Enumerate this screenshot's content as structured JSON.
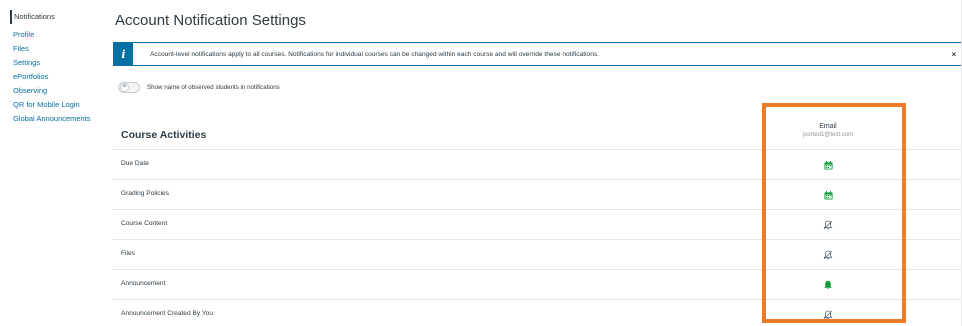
{
  "nav": {
    "items": [
      {
        "label": "Notifications",
        "active": true
      },
      {
        "label": "Profile"
      },
      {
        "label": "Files"
      },
      {
        "label": "Settings"
      },
      {
        "label": "ePortfolios"
      },
      {
        "label": "Observing"
      },
      {
        "label": "QR for Mobile Login"
      },
      {
        "label": "Global Announcements"
      }
    ]
  },
  "page": {
    "title": "Account Notification Settings"
  },
  "banner": {
    "icon": "i",
    "text": "Account-level notifications apply to all courses. Notifications for individual courses can be changed within each course and will override these notifications.",
    "close": "×"
  },
  "toggle": {
    "state_symbol": "×",
    "label": "Show name of observed students in notifications"
  },
  "section": {
    "title": "Course Activities"
  },
  "column": {
    "title": "Email",
    "subtitle": "jsorted1@test.com"
  },
  "rows": [
    {
      "label": "Due Date",
      "icon": "calendar-icon"
    },
    {
      "label": "Grading Policies",
      "icon": "calendar-icon"
    },
    {
      "label": "Course Content",
      "icon": "bell-off-icon"
    },
    {
      "label": "Files",
      "icon": "bell-off-icon"
    },
    {
      "label": "Announcement",
      "icon": "bell-icon"
    },
    {
      "label": "Announcement Created By You",
      "icon": "bell-off-icon"
    }
  ],
  "colors": {
    "link": "#0770a3",
    "text": "#2d3b45",
    "active_green": "#0b9b3a",
    "muted_gray": "#8b969e",
    "highlight_orange": "#f07b26"
  }
}
